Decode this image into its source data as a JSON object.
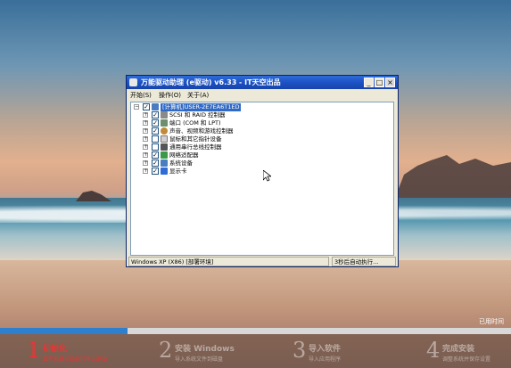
{
  "window": {
    "title": "万能驱动助理 (e驱动) v6.33 - IT天空出品",
    "menu": [
      "开始(S)",
      "操作(O)",
      "关于(A)"
    ],
    "controls": {
      "minimize": "_",
      "maximize": "□",
      "close": "×"
    }
  },
  "tree": {
    "root": "[计算机]USER-2E7EA6T1ED",
    "items": [
      {
        "label": "SCSI 和 RAID 控制器",
        "icon": "scsi-icon",
        "checked": true
      },
      {
        "label": "端口 (COM 和 LPT)",
        "icon": "port-icon",
        "checked": true
      },
      {
        "label": "声音、视频和游戏控制器",
        "icon": "sound-icon",
        "checked": true
      },
      {
        "label": "鼠标和其它指针设备",
        "icon": "mouse-icon",
        "checked": false
      },
      {
        "label": "通用串行总线控制器",
        "icon": "usb-icon",
        "checked": false
      },
      {
        "label": "网络适配器",
        "icon": "network-icon",
        "checked": true
      },
      {
        "label": "系统设备",
        "icon": "system-icon",
        "checked": true
      },
      {
        "label": "显示卡",
        "icon": "display-icon",
        "checked": true
      }
    ]
  },
  "statusbar": {
    "left": "Windows XP (X86) [部署环境]",
    "right": "3秒后自动执行..."
  },
  "clock_label": "已用时间",
  "progress": {
    "fraction": 0.25
  },
  "steps": [
    {
      "number": "1",
      "title": "初始化",
      "subtitle": "正在系统初始化和导入驱动",
      "state": "active"
    },
    {
      "number": "2",
      "title": "安装 Windows",
      "subtitle": "导入系统文件到磁盘",
      "state": "inactive"
    },
    {
      "number": "3",
      "title": "导入软件",
      "subtitle": "导入应用程序",
      "state": "inactive"
    },
    {
      "number": "4",
      "title": "完成安装",
      "subtitle": "调整系统并保存设置",
      "state": "inactive"
    }
  ],
  "colors": {
    "accent": "#e33333",
    "titlebar": "#1c52c5",
    "progress": "#2f7fcf"
  }
}
